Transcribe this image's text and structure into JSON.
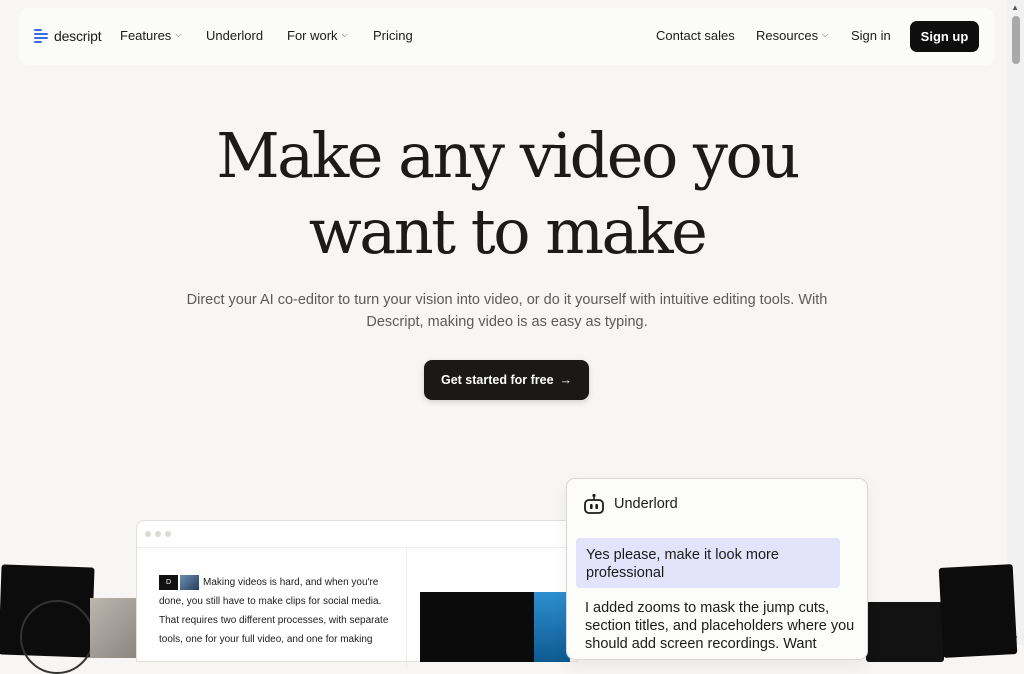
{
  "nav": {
    "logo_text": "descript",
    "features": "Features",
    "underlord": "Underlord",
    "for_work": "For work",
    "pricing": "Pricing",
    "contact_sales": "Contact sales",
    "resources": "Resources",
    "sign_in": "Sign in",
    "sign_up": "Sign up"
  },
  "hero": {
    "title_line1": "Make any video you",
    "title_line2": "want to make",
    "subtitle": "Direct your AI co-editor to turn your vision into video, or do it yourself with intuitive editing tools. With Descript, making video is as easy as typing.",
    "cta_label": "Get started for free",
    "cta_icon": "arrow-right-icon"
  },
  "preview": {
    "thumb_letter": "D",
    "transcript_text": "Making videos is hard, and when you're done, you still have to make clips for social media. That requires two different processes, with separate tools, one for your full video, and one for making"
  },
  "underlord_panel": {
    "title": "Underlord",
    "icon": "robot-icon",
    "user_message": "Yes please, make it look more professional",
    "ai_message": "I added zooms to mask the jump cuts, section titles, and placeholders where you should add screen recordings. Want"
  },
  "colors": {
    "background": "#f7f6f4",
    "brand_blue": "#3a6ce8",
    "button_dark": "#0e0e0e",
    "user_bubble": "#e3e3fb"
  }
}
